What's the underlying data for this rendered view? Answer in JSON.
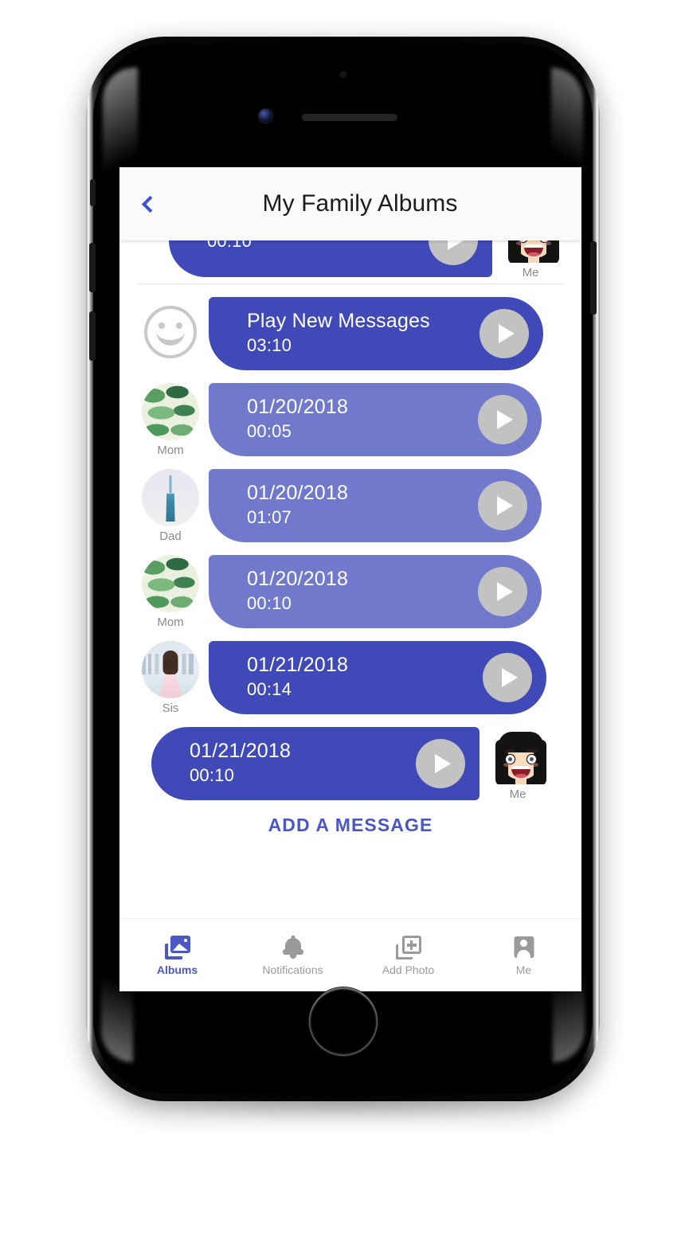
{
  "device": {
    "type": "smartphone",
    "icons": {
      "camera": "front-camera-icon",
      "earpiece": "earpiece-speaker-icon",
      "sensor": "proximity-sensor-icon",
      "home": "home-button"
    }
  },
  "header": {
    "title": "My Family Albums",
    "back_label": "back-chevron-icon"
  },
  "messages": [
    {
      "id": "msg-partial-me",
      "sender": "Me",
      "avatar": "bitmoji-me",
      "direction": "outgoing",
      "title": "",
      "duration": "00:10",
      "state": "unread",
      "partial": true
    },
    {
      "id": "msg-play-new",
      "sender": "",
      "avatar": "smiley-placeholder",
      "direction": "incoming",
      "title": "Play New Messages",
      "duration": "03:10",
      "state": "unread",
      "partial": false
    },
    {
      "id": "msg-mom-1",
      "sender": "Mom",
      "avatar": "photo-leaves",
      "direction": "incoming",
      "title": "01/20/2018",
      "duration": "00:05",
      "state": "read",
      "partial": false
    },
    {
      "id": "msg-dad-1",
      "sender": "Dad",
      "avatar": "photo-tower",
      "direction": "incoming",
      "title": "01/20/2018",
      "duration": "01:07",
      "state": "read",
      "partial": false
    },
    {
      "id": "msg-mom-2",
      "sender": "Mom",
      "avatar": "photo-leaves",
      "direction": "incoming",
      "title": "01/20/2018",
      "duration": "00:10",
      "state": "read",
      "partial": false
    },
    {
      "id": "msg-sis-1",
      "sender": "Sis",
      "avatar": "photo-girl",
      "direction": "incoming",
      "title": "01/21/2018",
      "duration": "00:14",
      "state": "unread",
      "partial": false
    },
    {
      "id": "msg-me-1",
      "sender": "Me",
      "avatar": "bitmoji-me",
      "direction": "outgoing",
      "title": "01/21/2018",
      "duration": "00:10",
      "state": "unread",
      "partial": false
    }
  ],
  "play_button_label": "play-icon",
  "add_message": {
    "label": "ADD A MESSAGE"
  },
  "tabbar": {
    "items": [
      {
        "label": "Albums",
        "icon": "albums-icon",
        "active": true
      },
      {
        "label": "Notifications",
        "icon": "bell-icon",
        "active": false
      },
      {
        "label": "Add Photo",
        "icon": "add-photo-icon",
        "active": false
      },
      {
        "label": "Me",
        "icon": "person-icon",
        "active": false
      }
    ]
  },
  "colors": {
    "unread_bubble": "#3f4ab8",
    "read_bubble": "#7079cc",
    "accent": "#4a57c4",
    "play_button": "#c2c2c2",
    "avatar_label": "#8a8a8a",
    "tab_inactive": "#9a9a9a"
  }
}
